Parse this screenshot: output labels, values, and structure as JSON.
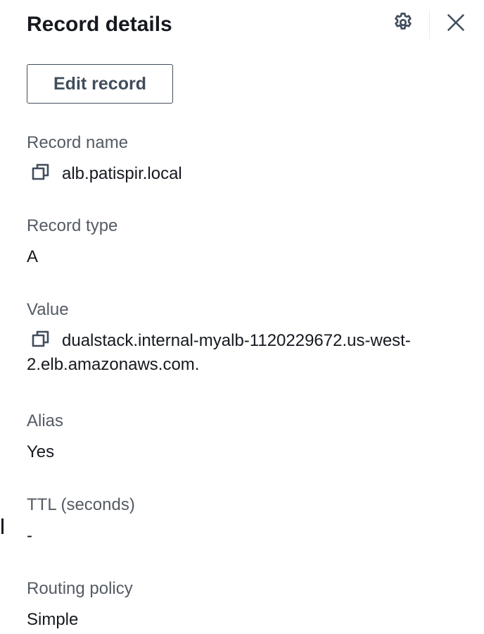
{
  "panel": {
    "title": "Record details",
    "settings_icon": "gear-icon",
    "close_icon": "close-icon"
  },
  "actions": {
    "edit_label": "Edit record"
  },
  "fields": {
    "record_name": {
      "label": "Record name",
      "value": "alb.patispir.local",
      "icon": "copy-icon"
    },
    "record_type": {
      "label": "Record type",
      "value": "A"
    },
    "value": {
      "label": "Value",
      "value": "dualstack.internal-myalb-1120229672.us-west-2.elb.amazonaws.com.",
      "icon": "copy-icon"
    },
    "alias": {
      "label": "Alias",
      "value": "Yes"
    },
    "ttl": {
      "label": "TTL (seconds)",
      "value": "-"
    },
    "routing_policy": {
      "label": "Routing policy",
      "value": "Simple"
    }
  },
  "colors": {
    "text": "#16191f",
    "label": "#545b64",
    "icon": "#414d5c",
    "button_border": "#414d5c",
    "divider": "#e9ebed"
  }
}
